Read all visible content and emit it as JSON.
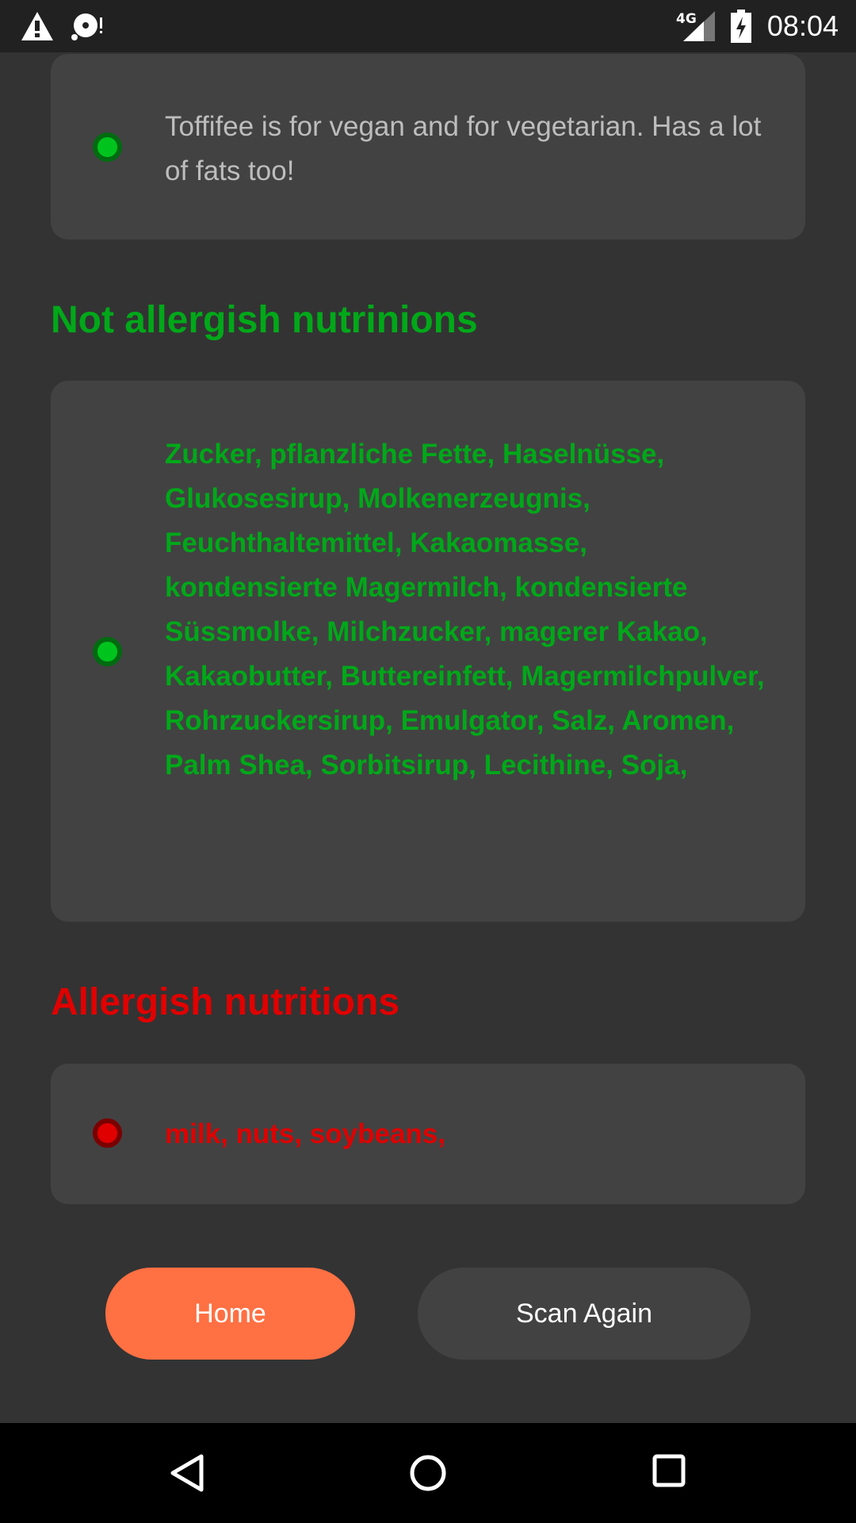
{
  "status_bar": {
    "time": "08:04",
    "network": "4G"
  },
  "summary": {
    "text": "Toffifee is for vegan and for vegetarian. Has a lot of fats too!"
  },
  "not_allergic": {
    "title": "Not allergish nutrinions",
    "text": "Zucker, pflanzliche Fette, Haselnüsse, Glukosesirup, Molkenerzeugnis, Feuchthaltemittel, Kakaomasse, kondensierte Magermilch, kondensierte Süssmolke, Milchzucker, magerer Kakao, Kakaobutter, Buttereinfett, Magermilchpulver, Rohrzuckersirup, Emulgator, Salz, Aromen, Palm Shea, Sorbitsirup, Lecithine, Soja,"
  },
  "allergic": {
    "title": "Allergish nutritions",
    "text": "milk, nuts, soybeans,"
  },
  "buttons": {
    "home": "Home",
    "scan_again": "Scan Again"
  },
  "colors": {
    "green": "#00a819",
    "red": "#e00000",
    "accent": "#ff7043"
  }
}
